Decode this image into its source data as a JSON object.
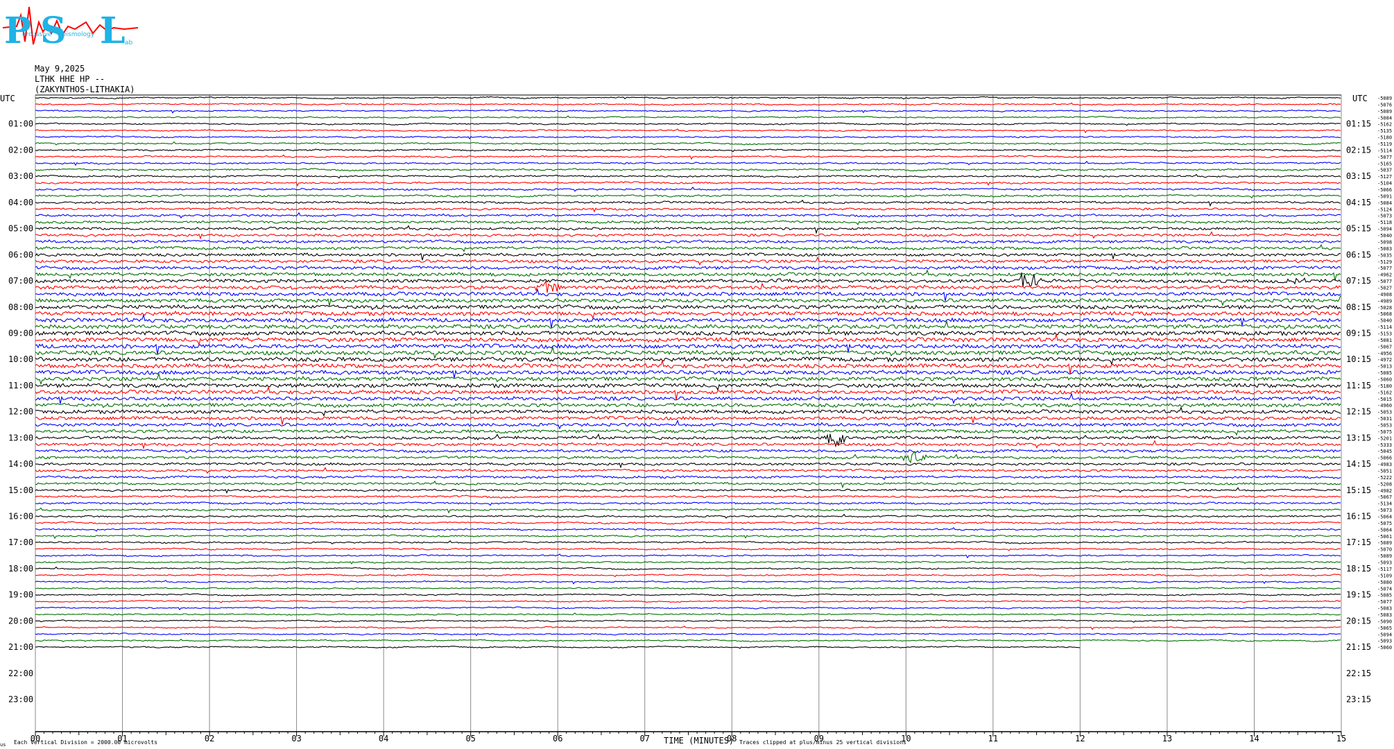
{
  "logo": {
    "letters": [
      "P",
      "S",
      "L"
    ],
    "words": [
      "ercussive",
      "eismology",
      "ab"
    ]
  },
  "header": {
    "date": "May 9,2025",
    "station": "LTHK HHE HP --",
    "location": "(ZAKYNTHOS-LITHAKIA)"
  },
  "chart_data": {
    "type": "line",
    "title": "",
    "xlabel": "TIME (MINUTES)",
    "ylabel": "UTC",
    "right_label": "UTC",
    "xlim": [
      0,
      15
    ],
    "x_ticks": [
      "00",
      "01",
      "02",
      "03",
      "04",
      "05",
      "06",
      "07",
      "08",
      "09",
      "10",
      "11",
      "12",
      "13",
      "14",
      "15"
    ],
    "left_hour_labels": [
      "01:00",
      "02:00",
      "03:00",
      "04:00",
      "05:00",
      "06:00",
      "07:00",
      "08:00",
      "09:00",
      "10:00",
      "11:00",
      "12:00",
      "13:00",
      "14:00",
      "15:00",
      "16:00",
      "17:00",
      "18:00",
      "19:00",
      "20:00",
      "21:00",
      "22:00",
      "23:00"
    ],
    "right_hour_labels": [
      "01:15",
      "02:15",
      "03:15",
      "04:15",
      "05:15",
      "06:15",
      "07:15",
      "08:15",
      "09:15",
      "10:15",
      "11:15",
      "12:15",
      "13:15",
      "14:15",
      "15:15",
      "16:15",
      "17:15",
      "18:15",
      "19:15",
      "20:15",
      "21:15",
      "22:15",
      "23:15"
    ],
    "trace_minutes": 15,
    "trace_count": 85,
    "trace_colors": [
      "#000000",
      "#ff0000",
      "#0000ff",
      "#007000"
    ],
    "last_trace_end_minute": 12.0,
    "trace_offsets": [
      "-5089",
      "-5076",
      "-5089",
      "-5084",
      "-5162",
      "-5135",
      "-5180",
      "-5119",
      "-5114",
      "-5077",
      "-5165",
      "-5037",
      "-5127",
      "-5104",
      "-5066",
      "-5091",
      "-5084",
      "-5124",
      "-5073",
      "-5118",
      "-5094",
      "-5040",
      "-5098",
      "-5083",
      "-5035",
      "-5129",
      "-5077",
      "-4962",
      "-5077",
      "-5027",
      "-4908",
      "-4989",
      "-5028",
      "-5068",
      "-5040",
      "-5114",
      "-5153",
      "-5081",
      "-5067",
      "-4956",
      "-4972",
      "-5013",
      "-5085",
      "-5060",
      "-5180",
      "-5162",
      "-5015",
      "-4960",
      "-5053",
      "-5031",
      "-5053",
      "-5075",
      "-5201",
      "-5333",
      "-5045",
      "-5066",
      "-4983",
      "-5051",
      "-5222",
      "-5208",
      "-4982",
      "-5067",
      "-5134",
      "-5073",
      "-5064",
      "-5075",
      "-5064",
      "-5061",
      "-5089",
      "-5070",
      "-5089",
      "-5093",
      "-5117",
      "-5109",
      "-5080",
      "-5074",
      "-5085",
      "-5077",
      "-5083",
      "-5083",
      "-5090",
      "-5065",
      "-5094",
      "-5093",
      "-5060"
    ],
    "events": [
      {
        "minute": 9.2,
        "trace": 52,
        "amplitude": 18
      },
      {
        "minute": 11.4,
        "trace": 28,
        "amplitude": 14
      },
      {
        "minute": 10.1,
        "trace": 55,
        "amplitude": 10
      },
      {
        "minute": 5.9,
        "trace": 29,
        "amplitude": 9
      },
      {
        "minute": 14.5,
        "trace": 28,
        "amplitude": 8
      }
    ]
  },
  "footer": {
    "scale_note": "Each Vertical Division = 2000.00 microvolts",
    "clip_note": "Traces clipped at plus/minus 25 vertical divisions",
    "corner_mark": "us"
  }
}
